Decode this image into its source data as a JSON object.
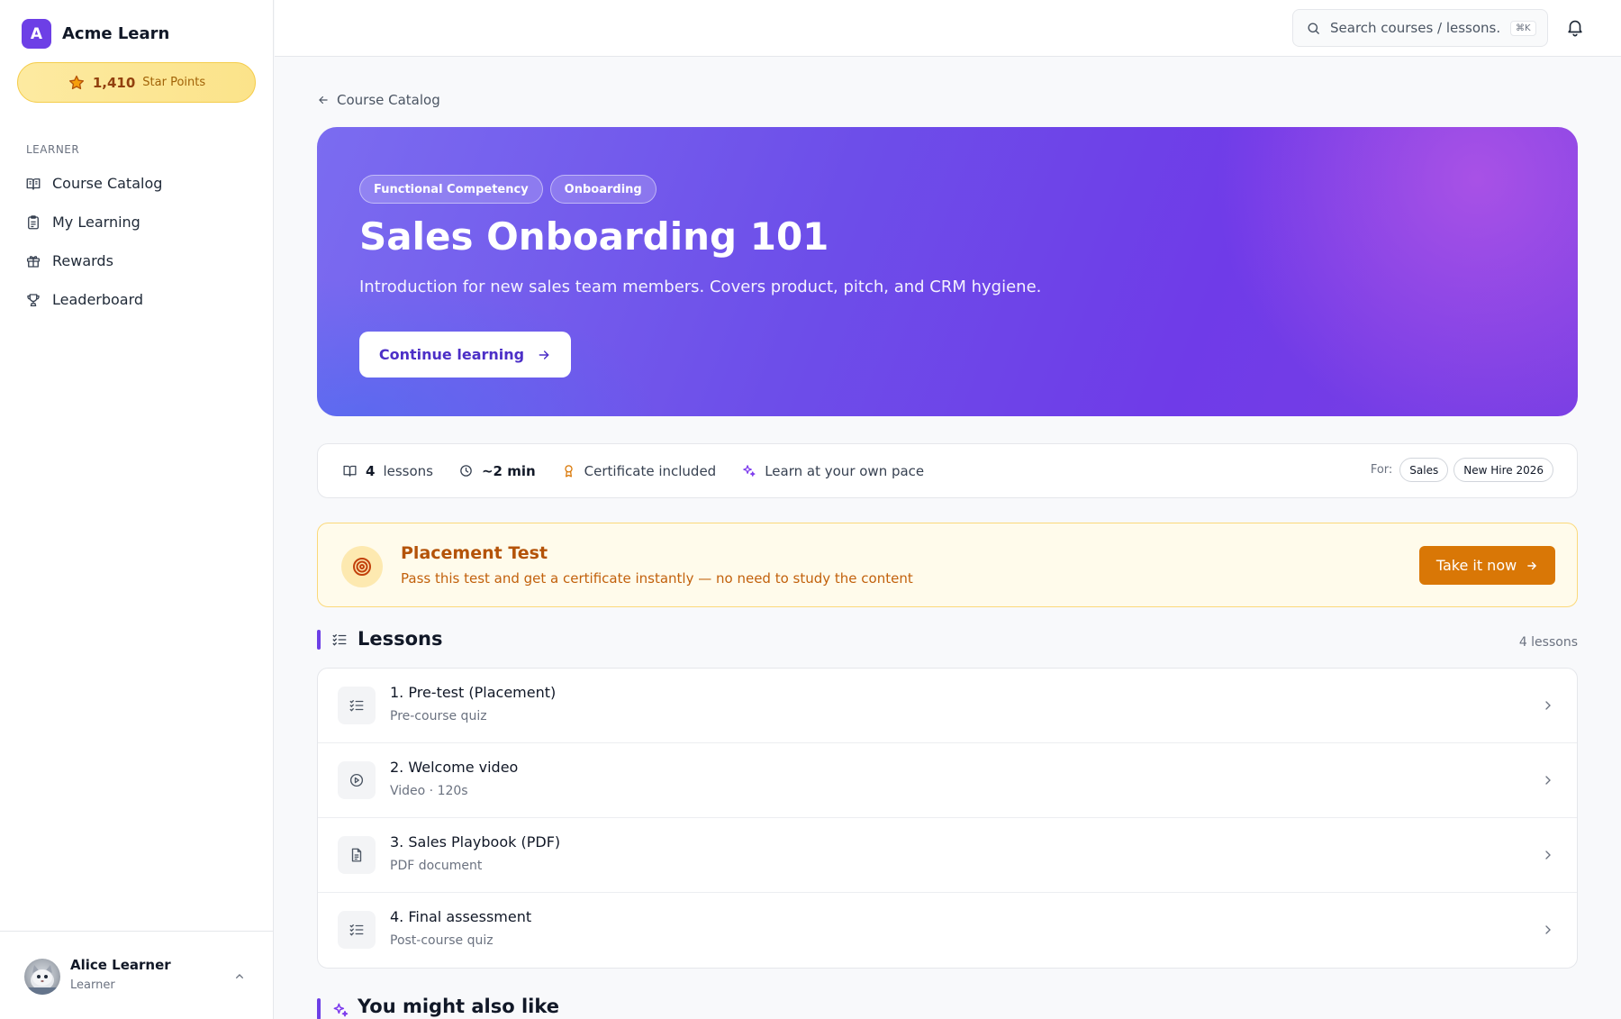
{
  "app": {
    "logo_letter": "A",
    "name": "Acme Learn"
  },
  "points": {
    "value": "1,410",
    "label": "Star Points"
  },
  "sidebar": {
    "section_label": "LEARNER",
    "items": [
      {
        "label": "Course Catalog",
        "icon": "book-open-icon"
      },
      {
        "label": "My Learning",
        "icon": "clipboard-icon"
      },
      {
        "label": "Rewards",
        "icon": "gift-icon"
      },
      {
        "label": "Leaderboard",
        "icon": "trophy-icon"
      }
    ]
  },
  "user": {
    "name": "Alice Learner",
    "role": "Learner"
  },
  "topbar": {
    "search_placeholder": "Search courses / lessons...",
    "shortcut": "⌘K"
  },
  "breadcrumb": {
    "label": "Course Catalog"
  },
  "hero": {
    "tags": [
      "Functional Competency",
      "Onboarding"
    ],
    "title": "Sales Onboarding 101",
    "description": "Introduction for new sales team members. Covers product, pitch, and CRM hygiene.",
    "cta": "Continue learning"
  },
  "meta": {
    "lessons_count": "4",
    "lessons_label": "lessons",
    "duration": "~2 min",
    "certificate": "Certificate included",
    "pace": "Learn at your own pace",
    "for_label": "For:",
    "audiences": [
      "Sales",
      "New Hire 2026"
    ]
  },
  "placement": {
    "title": "Placement Test",
    "description": "Pass this test and get a certificate instantly — no need to study the content",
    "button": "Take it now"
  },
  "lessons_section": {
    "title": "Lessons",
    "count": "4 lessons",
    "items": [
      {
        "title": "1. Pre-test (Placement)",
        "subtitle": "Pre-course quiz",
        "icon": "checklist-icon"
      },
      {
        "title": "2. Welcome video",
        "subtitle": "Video · 120s",
        "icon": "play-circle-icon"
      },
      {
        "title": "3. Sales Playbook (PDF)",
        "subtitle": "PDF document",
        "icon": "document-icon"
      },
      {
        "title": "4. Final assessment",
        "subtitle": "Post-course quiz",
        "icon": "checklist-icon"
      }
    ]
  },
  "also": {
    "title": "You might also like"
  },
  "colors": {
    "accent": "#6d3fe6",
    "warning": "#d97706",
    "points": "#fbe38a"
  }
}
